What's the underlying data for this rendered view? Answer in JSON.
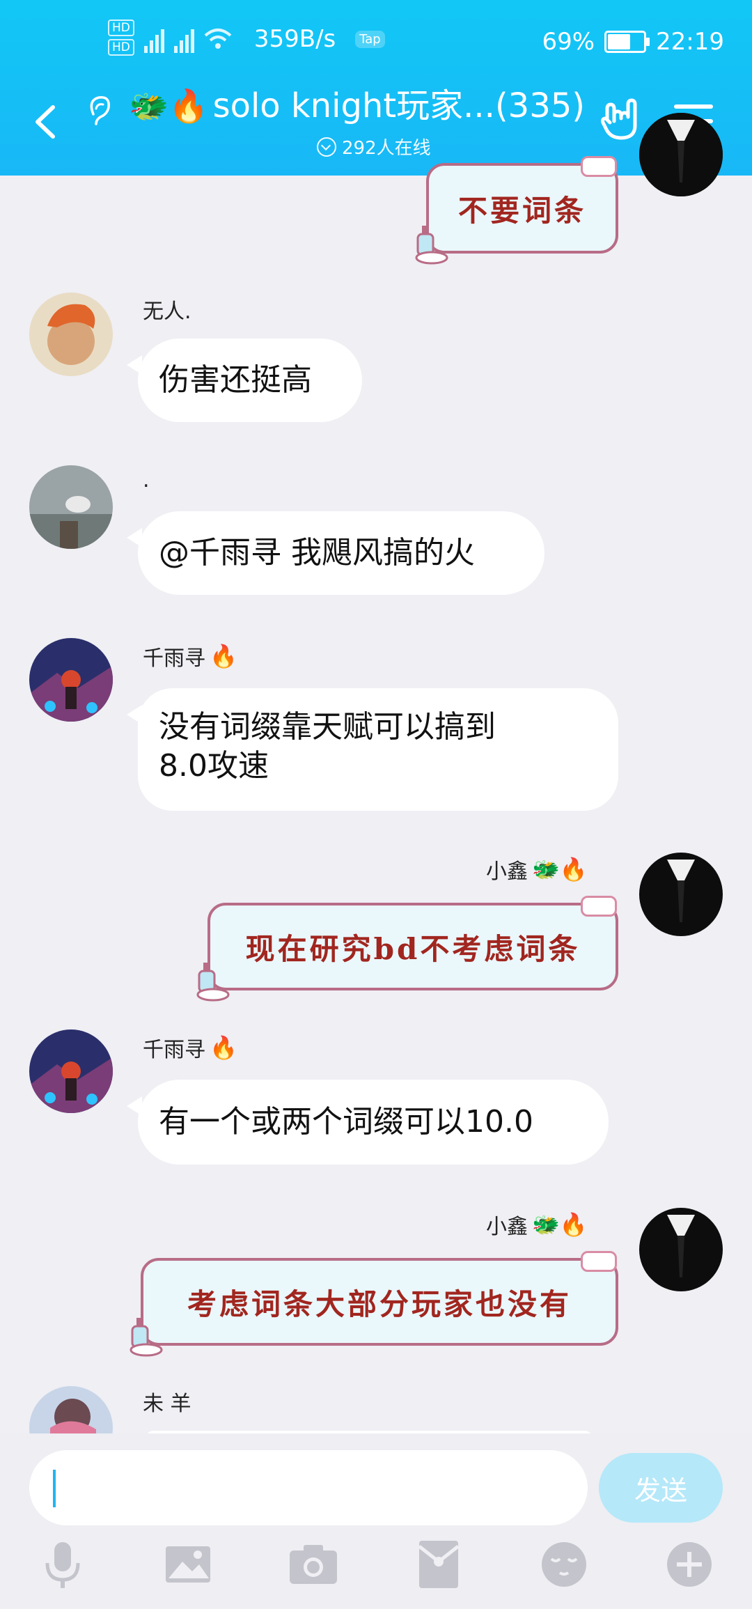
{
  "status_bar": {
    "hd1": "HD",
    "hd2": "HD",
    "net_speed": "359B/s",
    "tap_badge": "Tap",
    "battery": "69%",
    "battery_level": 0.69,
    "time": "22:19"
  },
  "header": {
    "title_emoji": "🐲🔥",
    "title": "solo knight玩家...(335)",
    "online": "292人在线"
  },
  "messages": [
    {
      "type": "sticker",
      "self": true,
      "text": "不要词条"
    },
    {
      "type": "text",
      "sender": "无人.",
      "sender_emoji": "",
      "text": "伤害还挺高"
    },
    {
      "type": "text",
      "sender": ".",
      "sender_emoji": "",
      "text": "@千雨寻 我飓风搞的火"
    },
    {
      "type": "text",
      "sender": "千雨寻",
      "sender_emoji": "🔥",
      "text": "没有词缀靠天赋可以搞到\n8.0攻速"
    },
    {
      "type": "sticker",
      "self": true,
      "sender": "小鑫",
      "sender_emoji": "🐲🔥",
      "text": "现在研究bd不考虑词条"
    },
    {
      "type": "text",
      "sender": "千雨寻",
      "sender_emoji": "🔥",
      "text": "有一个或两个词缀可以10.0"
    },
    {
      "type": "sticker",
      "self": true,
      "sender": "小鑫",
      "sender_emoji": "🐲🔥",
      "text": "考虑词条大部分玩家也没有"
    },
    {
      "type": "text",
      "sender": "未 羊",
      "sender_emoji": "",
      "text": ""
    }
  ],
  "input": {
    "value": "",
    "send_label": "发送"
  },
  "colors": {
    "header": "#14c0f6",
    "background": "#efeff4",
    "send_disabled": "#b5e8f9",
    "sticker_text": "#a1261f"
  },
  "toolbar_icons": [
    "mic-icon",
    "image-icon",
    "camera-icon",
    "red-packet-icon",
    "emoji-icon",
    "plus-icon"
  ]
}
